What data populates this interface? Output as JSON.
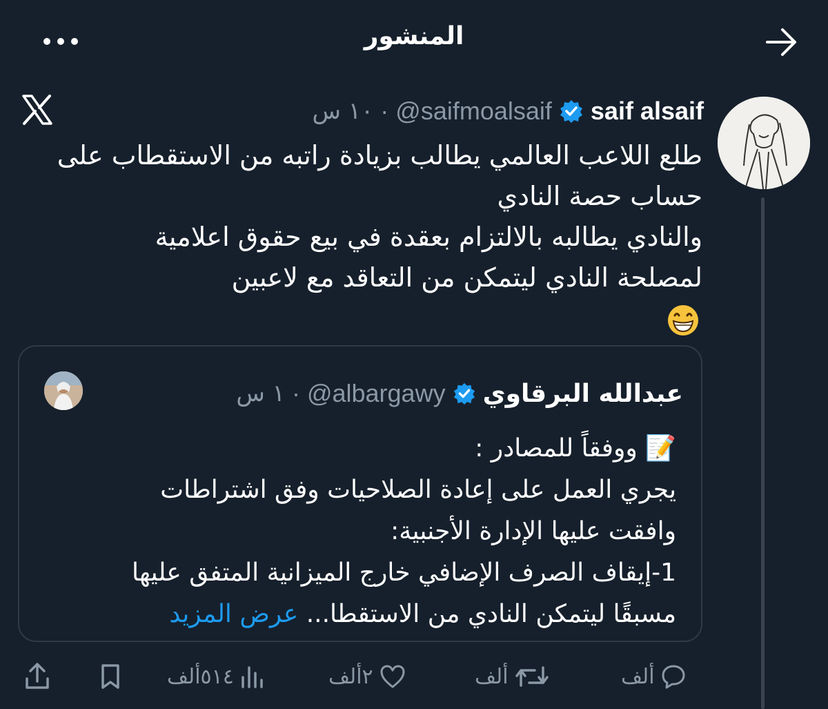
{
  "header": {
    "title": "المنشور"
  },
  "icons": {
    "back": "arrow-right-icon",
    "more": "more-dots-icon",
    "x_logo": "x-logo-icon",
    "verified": "verified-badge-icon"
  },
  "colors": {
    "background": "#16202c",
    "accent": "#1d9bf0",
    "muted": "#8b98a5",
    "verified": "#1d9bf0"
  },
  "post": {
    "author_name": "saif alsaif",
    "handle": "@saifmoalsaif",
    "separator": "·",
    "time": "١٠ س",
    "text_lines": [
      "طلع اللاعب العالمي يطالب بزيادة راتبه من الاستقطاب على",
      "حساب حصة النادي",
      "والنادي يطالبه بالالتزام بعقدة في بيع حقوق اعلامية",
      "لمصلحة النادي ليتمكن من التعاقد مع لاعبين"
    ],
    "emoji": "😁"
  },
  "quote": {
    "author_name": "عبدالله البرقاوي",
    "handle": "@albargawy",
    "separator": "·",
    "time": "١ س",
    "memo_emoji": "📝",
    "lines": [
      "ووفقاً للمصادر :",
      "يجري العمل على إعادة الصلاحيات وفق اشتراطات",
      "وافقت عليها الإدارة الأجنبية:",
      "1-إيقاف الصرف الإضافي خارج الميزانية المتفق عليها"
    ],
    "last_line": "مسبقًا ليتمكن النادي من الاستقطا...",
    "show_more": " عرض المزيد"
  },
  "actions": {
    "replies": "ألف",
    "reposts": "ألف",
    "likes": "٢ألف",
    "views": "٥١٤ألف"
  }
}
